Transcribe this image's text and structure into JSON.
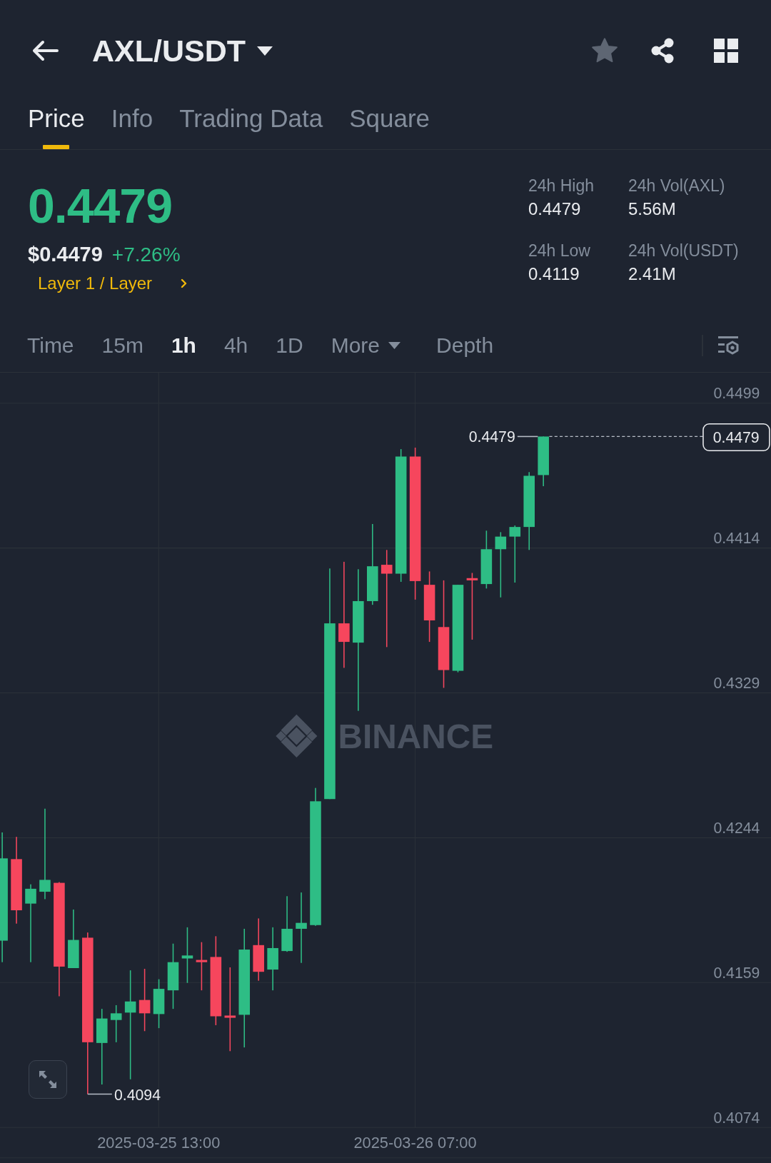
{
  "header": {
    "title": "AXL/USDT",
    "favorite": false
  },
  "tabs": [
    {
      "label": "Price",
      "selected": true
    },
    {
      "label": "Info",
      "selected": false
    },
    {
      "label": "Trading Data",
      "selected": false
    },
    {
      "label": "Square",
      "selected": false
    }
  ],
  "ticker": {
    "last_price": "0.4479",
    "usd_price": "$0.4479",
    "change": "+7.26%",
    "category": "Layer 1 / Layer"
  },
  "stats": [
    {
      "label": "24h High",
      "value": "0.4479"
    },
    {
      "label": "24h Vol(AXL)",
      "value": "5.56M"
    },
    {
      "label": "24h Low",
      "value": "0.4119"
    },
    {
      "label": "24h Vol(USDT)",
      "value": "2.41M"
    }
  ],
  "intervals": [
    {
      "label": "Time",
      "kind": "interval",
      "selected": false
    },
    {
      "label": "15m",
      "kind": "interval",
      "selected": false
    },
    {
      "label": "1h",
      "kind": "interval",
      "selected": true
    },
    {
      "label": "4h",
      "kind": "interval",
      "selected": false
    },
    {
      "label": "1D",
      "kind": "interval",
      "selected": false
    },
    {
      "label": "More",
      "kind": "dropdown",
      "selected": false
    },
    {
      "label": "Depth",
      "kind": "view",
      "selected": false
    }
  ],
  "chart": {
    "watermark": "BINANCE",
    "price_ticks": [
      "0.4499",
      "0.4414",
      "0.4329",
      "0.4244",
      "0.4159",
      "0.4074"
    ],
    "time_labels": [
      "2025-03-25 13:00",
      "2025-03-26 07:00"
    ],
    "high_marker": "0.4479",
    "low_marker": "0.4094",
    "current_price": "0.4479"
  }
}
